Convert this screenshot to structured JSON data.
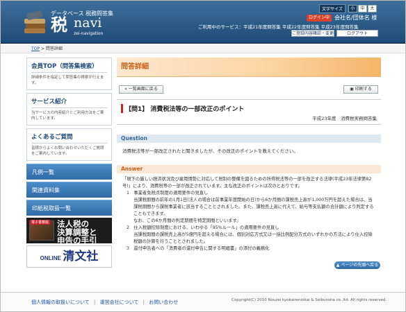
{
  "header": {
    "logo_sub": "データベース 税務問答集",
    "logo_main": "税",
    "logo_navi": "navi",
    "logo_tag": "zei-navigation",
    "font_size_label": "文字サイズ",
    "font_sizes": [
      "小",
      "中",
      "大"
    ],
    "login_status": "ログイン中",
    "member_name": "会社名/団体名 様",
    "services_text": "ご利用中のサービス：平成21年度問答集 平成22年度問答集 平成23年度問答集",
    "register_button": "ご登録内容確認・変更",
    "logout_button": "ログアウト"
  },
  "breadcrumb": {
    "top": "TOP",
    "separator": ">",
    "current": "問答詳細"
  },
  "sidebar": {
    "boxes": [
      {
        "title": "会員TOP（問答集検索）",
        "desc": "詳細条件を指定して問答集の検索が行えます。"
      },
      {
        "title": "サービス紹介",
        "desc": "当サービスの内容紹介とご利用方法をご案内しています。"
      },
      {
        "title": "よくあるご質問",
        "desc": "皆様からよくお問い合わせいただくご質問をご案内しています。"
      }
    ],
    "nav": [
      "凡例一覧",
      "関連資料集",
      "印紙税取扱一覧"
    ],
    "banner1_tag": "電子書籍版",
    "banner1_lines": [
      "法人税の",
      "決算調整と",
      "申告の手引"
    ],
    "banner2_online": "ONLINE",
    "banner2_brand": "清文社"
  },
  "main": {
    "page_title": "問答詳細",
    "back_button": "« 一覧画面に戻る",
    "print_button": "印刷する",
    "question_title": "【問1】 消費税法等の一部改正のポイント",
    "question_sub": "平成23年度　消費税実務問答集",
    "question_label": "Question",
    "question_text": "消費税法等が一部改正されたと聞きましたが、その改正のポイントを教えてください。",
    "answer_label": "Answer",
    "answer_lines": [
      {
        "text": "「現下の厳しい経済状況及び雇用情勢に対応して税制の整備を図るための所得税法等の一部を改正する法律(平成23年法律第82号)」により、消費税等の一部が改正されています。主な改正のポイントは次のとおりです。",
        "indent": 0
      },
      {
        "text": "1　事業者免税点制度の適用要件の見直し",
        "indent": 1
      },
      {
        "text": "当課税期間の前年の1月1日(法人の場合は前事業年度開始の日)から6か月間の課税売上高が1,000万円を超えた場合は、当課税期間から課税事業者に該当することとされました。また、課税売上高に代えて、給与等支払額の合計額により判定することもできます。",
        "indent": 2
      },
      {
        "text": "なお、この6か月間の判定期間を特定期間といいます。",
        "indent": 2
      },
      {
        "text": "2　仕入税額控除制度における、いわゆる「95%ルール」の適用要件の見直し",
        "indent": 1
      },
      {
        "text": "当課税期間の課税売上高が5億円を超える場合には、個別対応方式又は一括比例配分方式のいずれかの方法により仕入控除税額の計算を行うこととされました。",
        "indent": 2
      },
      {
        "text": "3　還付申告者への「消費者の還付申告に関する明細書」の添付の義務化",
        "indent": 1
      }
    ],
    "page_top_button": "ページの先頭へ戻る"
  },
  "footer": {
    "links": [
      "個人情報の取扱いについて",
      "運営会社について",
      "お問い合わせ"
    ],
    "copyright": "Copyright(C) 2010 Nouzei kyokairenoikai & Seibunsha co.,ltd. All rights reserved."
  }
}
